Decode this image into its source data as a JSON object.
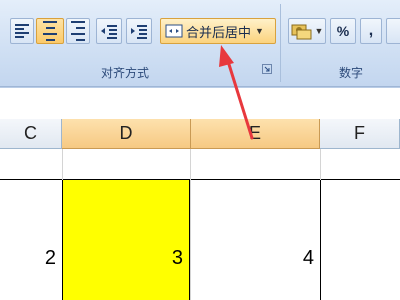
{
  "ribbon": {
    "alignment_group_label": "对齐方式",
    "number_group_label": "数字",
    "merge_button_label": "合并后居中",
    "percent_label": "%",
    "comma_label": ","
  },
  "columns": [
    "C",
    "D",
    "E",
    "F"
  ],
  "cells": {
    "c": "2",
    "d": "3",
    "e": "4"
  },
  "colors": {
    "highlight_fill": "#ffff00",
    "arrow": "#e8383d"
  }
}
